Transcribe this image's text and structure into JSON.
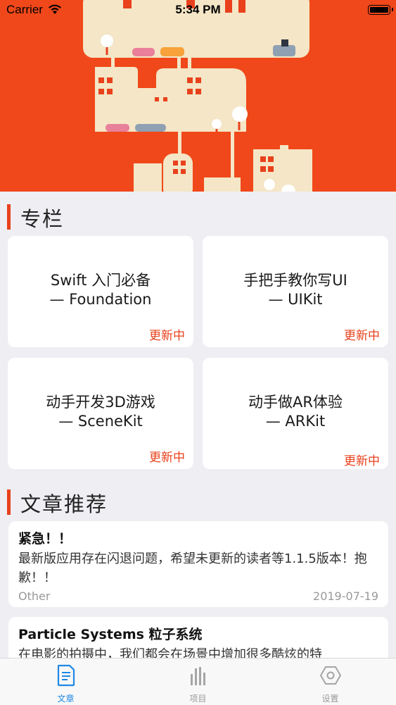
{
  "status_bar": {
    "carrier": "Carrier",
    "time": "5:34 PM"
  },
  "columns_section": {
    "title": "专栏"
  },
  "columns": [
    {
      "line1": "Swift 入门必备",
      "line2": "— Foundation",
      "status": "更新中"
    },
    {
      "line1": "手把手教你写UI",
      "line2": "— UIKit",
      "status": "更新中"
    },
    {
      "line1": "动手开发3D游戏",
      "line2": "— SceneKit",
      "status": "更新中"
    },
    {
      "line1": "动手做AR体验",
      "line2": "— ARKit",
      "status": "更新中"
    }
  ],
  "articles_section": {
    "title": "文章推荐"
  },
  "articles": [
    {
      "title": "紧急！！",
      "body": "最新版应用存在闪退问题，希望未更新的读者等1.1.5版本！抱歉！！",
      "category": "Other",
      "date": "2019-07-19"
    },
    {
      "title": "Particle Systems 粒子系统",
      "body": "在电影的拍摄中，我们都会在场景中增加很多酷炫的特",
      "category": "",
      "date": ""
    }
  ],
  "tabs": [
    {
      "label": "文章",
      "icon": "document-icon",
      "active": true
    },
    {
      "label": "项目",
      "icon": "bars-icon",
      "active": false
    },
    {
      "label": "设置",
      "icon": "hexagon-settings-icon",
      "active": false
    }
  ],
  "colors": {
    "accent": "#e8411c",
    "hero_background": "#f0481a",
    "city": "#f4e6c6",
    "tab_active": "#1e88e5"
  }
}
